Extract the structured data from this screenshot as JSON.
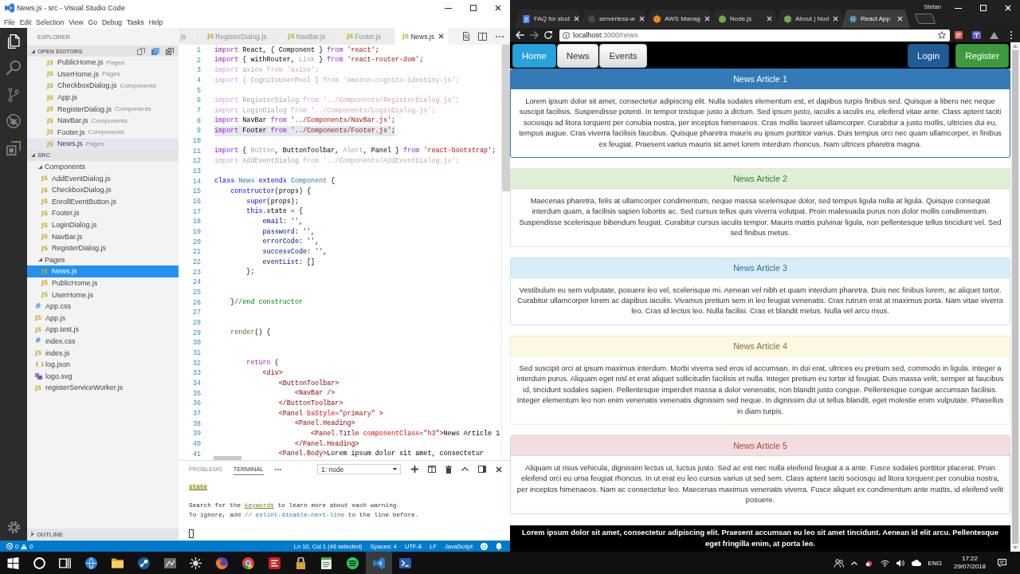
{
  "vscode": {
    "title": "News.js - src - Visual Studio Code",
    "menu": [
      "File",
      "Edit",
      "Selection",
      "View",
      "Go",
      "Debug",
      "Tasks",
      "Help"
    ],
    "activity_bar": [
      {
        "kind": "files",
        "selected": true
      },
      {
        "kind": "search",
        "selected": false
      },
      {
        "kind": "branch",
        "selected": false
      },
      {
        "kind": "bug",
        "selected": false
      },
      {
        "kind": "blocks",
        "selected": false
      }
    ],
    "sidebar": {
      "title": "EXPLORER",
      "open_editors": {
        "label": "OPEN EDITORS",
        "expanded": true,
        "items": [
          {
            "name": "PublicHome.js",
            "folder": "Pages",
            "kind": "js",
            "icon": "JS",
            "selected": false
          },
          {
            "name": "UserHome.js",
            "folder": "Pages",
            "kind": "js",
            "icon": "JS",
            "selected": false
          },
          {
            "name": "CheckboxDialog.js",
            "folder": "Components",
            "kind": "js",
            "icon": "JS",
            "selected": false
          },
          {
            "name": "App.js",
            "kind": "js",
            "icon": "JS",
            "selected": false
          },
          {
            "name": "RegisterDialog.js",
            "folder": "Components",
            "kind": "js",
            "icon": "JS",
            "selected": false
          },
          {
            "name": "NavBar.js",
            "folder": "Components",
            "kind": "js",
            "icon": "JS",
            "selected": false
          },
          {
            "name": "Footer.js",
            "folder": "Components",
            "kind": "js",
            "icon": "JS",
            "selected": false
          },
          {
            "name": "News.js",
            "folder": "Pages",
            "kind": "js",
            "icon": "JS",
            "selected": true
          }
        ]
      },
      "root": {
        "label": "SRC",
        "expanded": true,
        "children": [
          {
            "name": "Components",
            "kind": "folder",
            "expanded": true,
            "selected": false,
            "children": [
              {
                "name": "AddEventDialog.js",
                "kind": "js",
                "icon": "JS",
                "selected": false
              },
              {
                "name": "CheckboxDialog.js",
                "kind": "js",
                "icon": "JS",
                "selected": false
              },
              {
                "name": "EnrollEventButton.js",
                "kind": "js",
                "icon": "JS",
                "selected": false
              },
              {
                "name": "Footer.js",
                "kind": "js",
                "icon": "JS",
                "selected": false
              },
              {
                "name": "LoginDialog.js",
                "kind": "js",
                "icon": "JS",
                "selected": false
              },
              {
                "name": "NavBar.js",
                "kind": "js",
                "icon": "JS",
                "selected": false
              },
              {
                "name": "RegisterDialog.js",
                "kind": "js",
                "icon": "JS",
                "selected": false
              }
            ]
          },
          {
            "name": "Pages",
            "kind": "folder",
            "expanded": true,
            "selected": false,
            "children": [
              {
                "name": "News.js",
                "kind": "js",
                "icon": "JS",
                "selected": true
              },
              {
                "name": "PublicHome.js",
                "kind": "js",
                "icon": "JS",
                "selected": false
              },
              {
                "name": "UserHome.js",
                "kind": "js",
                "icon": "JS",
                "selected": false
              }
            ]
          },
          {
            "name": "App.css",
            "kind": "css",
            "icon": "#",
            "selected": false
          },
          {
            "name": "App.js",
            "kind": "js",
            "icon": "JS",
            "selected": false
          },
          {
            "name": "App.test.js",
            "kind": "js",
            "icon": "JS",
            "selected": false
          },
          {
            "name": "index.css",
            "kind": "css",
            "icon": "#",
            "selected": false
          },
          {
            "name": "index.js",
            "kind": "js",
            "icon": "JS",
            "selected": false
          },
          {
            "name": "log.json",
            "kind": "json",
            "icon": "{ }",
            "selected": false
          },
          {
            "name": "logo.svg",
            "kind": "svg",
            "selected": false
          },
          {
            "name": "registerServiceWorker.js",
            "kind": "js",
            "icon": "JS",
            "selected": false
          }
        ]
      },
      "outline": {
        "label": "OUTLINE",
        "expanded": false
      }
    },
    "tabs": [
      {
        "label": "js",
        "selected": false
      },
      {
        "icon": "JS",
        "label": "RegisterDialog.js",
        "selected": false
      },
      {
        "icon": "JS",
        "label": "NavBar.js",
        "selected": false
      },
      {
        "icon": "JS",
        "label": "Footer.js",
        "selected": false
      },
      {
        "icon": "JS",
        "label": "News.js",
        "selected": true
      }
    ],
    "editor": {
      "lines": [
        {
          "number": "1",
          "selected": false,
          "tokens": [
            {
              "text": "import ",
              "kind": "ctl"
            },
            {
              "text": "React, { Component } ",
              "kind": "txt"
            },
            {
              "text": "from ",
              "kind": "ctl"
            },
            {
              "text": "'react'",
              "kind": "str"
            },
            {
              "text": ";",
              "kind": "txt"
            }
          ]
        },
        {
          "number": "2",
          "selected": false,
          "tokens": [
            {
              "text": "import ",
              "kind": "ctl"
            },
            {
              "text": "{ withRouter, ",
              "kind": "txt"
            },
            {
              "text": "Link",
              "kind": "dim"
            },
            {
              "text": " } ",
              "kind": "txt"
            },
            {
              "text": "from ",
              "kind": "ctl"
            },
            {
              "text": "'react-router-dom'",
              "kind": "str"
            },
            {
              "text": ";",
              "kind": "txt"
            }
          ]
        },
        {
          "number": "3",
          "selected": false,
          "tokens": [
            {
              "text": "import ",
              "kind": "dctl"
            },
            {
              "text": "axios ",
              "kind": "dim"
            },
            {
              "text": "from ",
              "kind": "dctl"
            },
            {
              "text": "'axios'",
              "kind": "dstr"
            },
            {
              "text": ";",
              "kind": "dim"
            }
          ]
        },
        {
          "number": "4",
          "selected": false,
          "tokens": [
            {
              "text": "import ",
              "kind": "dctl"
            },
            {
              "text": "{ CognitoUserPool } ",
              "kind": "dim"
            },
            {
              "text": "from ",
              "kind": "dctl"
            },
            {
              "text": "'amazon-cognito-identity-js'",
              "kind": "dstr"
            },
            {
              "text": ";",
              "kind": "dim"
            }
          ]
        },
        {
          "number": "5",
          "selected": false
        },
        {
          "number": "6",
          "selected": false,
          "tokens": [
            {
              "text": "import ",
              "kind": "dctl"
            },
            {
              "text": "RegisterDialog ",
              "kind": "dim"
            },
            {
              "text": "from ",
              "kind": "dctl"
            },
            {
              "text": "'../Components/RegisterDialog.js'",
              "kind": "dstr"
            },
            {
              "text": ";",
              "kind": "dim"
            }
          ]
        },
        {
          "number": "7",
          "selected": false,
          "tokens": [
            {
              "text": "import ",
              "kind": "dctl"
            },
            {
              "text": "LoginDialog ",
              "kind": "dim"
            },
            {
              "text": "from ",
              "kind": "dctl"
            },
            {
              "text": "'../Components/LoginDialog.js'",
              "kind": "dstr"
            },
            {
              "text": ";",
              "kind": "dim"
            }
          ]
        },
        {
          "number": "8",
          "selected": false,
          "tokens": [
            {
              "text": "import ",
              "kind": "ctl"
            },
            {
              "text": "NavBar ",
              "kind": "txt"
            },
            {
              "text": "from ",
              "kind": "ctl"
            },
            {
              "text": "'../Components/NavBar.js'",
              "kind": "str"
            },
            {
              "text": ";",
              "kind": "txt"
            }
          ]
        },
        {
          "number": "9",
          "selected": true,
          "tokens": [
            {
              "text": "import ",
              "kind": "ctl"
            },
            {
              "text": "Footer ",
              "kind": "txt"
            },
            {
              "text": "from ",
              "kind": "ctl"
            },
            {
              "text": "'../Components/Footer.js'",
              "kind": "str"
            },
            {
              "text": ";",
              "kind": "txt"
            }
          ]
        },
        {
          "number": "10",
          "selected": false
        },
        {
          "number": "11",
          "selected": false,
          "tokens": [
            {
              "text": "import ",
              "kind": "ctl"
            },
            {
              "text": "{ ",
              "kind": "txt"
            },
            {
              "text": "Button",
              "kind": "dim"
            },
            {
              "text": ", ButtonToolbar, ",
              "kind": "txt"
            },
            {
              "text": "Alert",
              "kind": "dim"
            },
            {
              "text": ", Panel } ",
              "kind": "txt"
            },
            {
              "text": "from ",
              "kind": "ctl"
            },
            {
              "text": "'react-bootstrap'",
              "kind": "str"
            },
            {
              "text": ";",
              "kind": "txt"
            }
          ]
        },
        {
          "number": "12",
          "selected": false,
          "tokens": [
            {
              "text": "import ",
              "kind": "dctl"
            },
            {
              "text": "AddEventDialog ",
              "kind": "dim"
            },
            {
              "text": "from ",
              "kind": "dctl"
            },
            {
              "text": "'../Components/AddEventDialog.js'",
              "kind": "dstr"
            },
            {
              "text": ";",
              "kind": "dim"
            }
          ]
        },
        {
          "number": "13",
          "selected": false
        },
        {
          "number": "14",
          "selected": false,
          "tokens": [
            {
              "text": "class ",
              "kind": "kw"
            },
            {
              "text": "News ",
              "kind": "type"
            },
            {
              "text": "extends ",
              "kind": "kw"
            },
            {
              "text": "Component ",
              "kind": "type"
            },
            {
              "text": "{",
              "kind": "txt"
            }
          ]
        },
        {
          "number": "15",
          "selected": false,
          "tokens": [
            {
              "text": "    constructor",
              "kind": "kw"
            },
            {
              "text": "(props) {",
              "kind": "txt"
            }
          ]
        },
        {
          "number": "16",
          "selected": false,
          "tokens": [
            {
              "text": "        super",
              "kind": "kw"
            },
            {
              "text": "(props);",
              "kind": "txt"
            }
          ]
        },
        {
          "number": "17",
          "selected": false,
          "tokens": [
            {
              "text": "        this",
              "kind": "kw"
            },
            {
              "text": ".state = {",
              "kind": "txt"
            }
          ]
        },
        {
          "number": "18",
          "selected": false,
          "tokens": [
            {
              "text": "            email",
              "kind": "prop"
            },
            {
              "text": ": ",
              "kind": "txt"
            },
            {
              "text": "''",
              "kind": "str"
            },
            {
              "text": ",",
              "kind": "txt"
            }
          ]
        },
        {
          "number": "19",
          "selected": false,
          "tokens": [
            {
              "text": "            password",
              "kind": "prop"
            },
            {
              "text": ": ",
              "kind": "txt"
            },
            {
              "text": "''",
              "kind": "str"
            },
            {
              "text": ",",
              "kind": "txt"
            }
          ]
        },
        {
          "number": "20",
          "selected": false,
          "tokens": [
            {
              "text": "            errorCode",
              "kind": "prop"
            },
            {
              "text": ": ",
              "kind": "txt"
            },
            {
              "text": "''",
              "kind": "str"
            },
            {
              "text": ",",
              "kind": "txt"
            }
          ]
        },
        {
          "number": "21",
          "selected": false,
          "tokens": [
            {
              "text": "            successCode",
              "kind": "prop"
            },
            {
              "text": ": ",
              "kind": "txt"
            },
            {
              "text": "''",
              "kind": "str"
            },
            {
              "text": ",",
              "kind": "txt"
            }
          ]
        },
        {
          "number": "22",
          "selected": false,
          "tokens": [
            {
              "text": "            eventList",
              "kind": "prop"
            },
            {
              "text": ": []",
              "kind": "txt"
            }
          ]
        },
        {
          "number": "23",
          "selected": false,
          "tokens": [
            {
              "text": "        };",
              "kind": "txt"
            }
          ]
        },
        {
          "number": "24",
          "selected": false
        },
        {
          "number": "25",
          "selected": false
        },
        {
          "number": "26",
          "selected": false,
          "tokens": [
            {
              "text": "    }",
              "kind": "txt"
            },
            {
              "text": "//end constructor",
              "kind": "com"
            }
          ]
        },
        {
          "number": "27",
          "selected": false
        },
        {
          "number": "28",
          "selected": false
        },
        {
          "number": "29",
          "selected": false,
          "tokens": [
            {
              "text": "    render",
              "kind": "fn"
            },
            {
              "text": "() {",
              "kind": "txt"
            }
          ]
        },
        {
          "number": "30",
          "selected": false
        },
        {
          "number": "31",
          "selected": false
        },
        {
          "number": "32",
          "selected": false,
          "tokens": [
            {
              "text": "        return ",
              "kind": "ctl"
            },
            {
              "text": "(",
              "kind": "txt"
            }
          ]
        },
        {
          "number": "33",
          "selected": false,
          "tokens": [
            {
              "text": "            <div>",
              "kind": "tag"
            }
          ]
        },
        {
          "number": "34",
          "selected": false,
          "tokens": [
            {
              "text": "                <ButtonToolbar>",
              "kind": "tag"
            }
          ]
        },
        {
          "number": "35",
          "selected": false,
          "tokens": [
            {
              "text": "                    <NavBar />",
              "kind": "tag"
            }
          ]
        },
        {
          "number": "36",
          "selected": false,
          "tokens": [
            {
              "text": "                </ButtonToolbar>",
              "kind": "tag"
            }
          ]
        },
        {
          "number": "37",
          "selected": false,
          "tokens": [
            {
              "text": "                <Panel ",
              "kind": "tag"
            },
            {
              "text": "bsStyle",
              "kind": "attr"
            },
            {
              "text": "=",
              "kind": "txt"
            },
            {
              "text": "\"primary\"",
              "kind": "str"
            },
            {
              "text": " >",
              "kind": "tag"
            }
          ]
        },
        {
          "number": "38",
          "selected": false,
          "tokens": [
            {
              "text": "                    <Panel.Heading>",
              "kind": "tag"
            }
          ]
        },
        {
          "number": "39",
          "selected": false,
          "tokens": [
            {
              "text": "                        <Panel.Title ",
              "kind": "tag"
            },
            {
              "text": "componentClass",
              "kind": "attr"
            },
            {
              "text": "=",
              "kind": "txt"
            },
            {
              "text": "\"h3\"",
              "kind": "str"
            },
            {
              "text": ">",
              "kind": "tag"
            },
            {
              "text": "News Article 1",
              "kind": "txt"
            }
          ]
        },
        {
          "number": "40",
          "selected": false,
          "tokens": [
            {
              "text": "                    </Panel.Heading>",
              "kind": "tag"
            }
          ]
        },
        {
          "number": "41",
          "selected": false,
          "tokens": [
            {
              "text": "                <Panel.Body>",
              "kind": "tag"
            },
            {
              "text": "Lorem ipsum dolor sit amet, consectetur",
              "kind": "txt"
            }
          ]
        }
      ]
    },
    "panel": {
      "tabs": [
        {
          "label": "PROBLEMS",
          "selected": false
        },
        {
          "label": "TERMINAL",
          "selected": true
        }
      ],
      "terminal_picker": "1: node",
      "output": [
        {
          "lines": [
            {
              "tokens": [
                {
                  "text": "state",
                  "kind": "match"
                }
              ]
            }
          ]
        },
        {
          "lines": [
            {
              "tokens": [
                {
                  "text": "Search for the ",
                  "kind": "text"
                },
                {
                  "text": "keywords",
                  "kind": "link"
                },
                {
                  "text": " to learn more about each warning.",
                  "kind": "text"
                }
              ]
            },
            {
              "tokens": [
                {
                  "text": "To ignore, add ",
                  "kind": "text"
                },
                {
                  "text": "// eslint-disable-next-line",
                  "kind": "code"
                },
                {
                  "text": " to the line before.",
                  "kind": "text"
                }
              ]
            }
          ]
        }
      ]
    },
    "status_bar": {
      "errors": "0",
      "warnings": "0",
      "items": [
        "Ln 10, Col 1 (46 selected)",
        "Spaces: 4",
        "UTF-8",
        "LF",
        "JavaScript"
      ]
    }
  },
  "browser": {
    "profile": "Stefan",
    "tabs": [
      {
        "title": "FAQ for stud",
        "kind": "document",
        "selected": false
      },
      {
        "title": "serverless-w",
        "kind": "circle",
        "selected": false
      },
      {
        "title": "AWS Manag",
        "kind": "cube",
        "selected": false
      },
      {
        "title": "Node.js",
        "kind": "hexagon",
        "selected": false
      },
      {
        "title": "About | Nod",
        "kind": "hexagon",
        "selected": false
      },
      {
        "title": "React App",
        "kind": "atom",
        "selected": true
      }
    ],
    "toolbar": {
      "back": {
        "disabled": false
      },
      "forward": {
        "disabled": true
      }
    },
    "address": {
      "host": "localhost",
      "path": ":3000/news"
    },
    "navbar": {
      "left": [
        {
          "label": "Home",
          "kind": "info"
        },
        {
          "label": "News",
          "kind": "default"
        },
        {
          "label": "Events",
          "kind": "default"
        }
      ],
      "right": [
        {
          "label": "Login",
          "kind": "primary"
        },
        {
          "label": "Register",
          "kind": "success"
        }
      ]
    },
    "articles": [
      {
        "title": "News Article 1",
        "kind": "primary",
        "body": "Lorem ipsum dolor sit amet, consectetur adipiscing elit. Nulla sodales elementum est, et dapibus turpis finibus sed. Quisque a libero nec neque suscipit facilisis. Suspendisse potenti. In tempor tristique justo a dictum. Sed ipsum justo, iaculis a iaculis eu, eleifend vitae ante. Class aptent taciti sociosqu ad litora torquent per conubia nostra, per inceptos himenaeos. Cras mollis laoreet ullamcorper. Curabitur a justo mollis, ultricies dui eu, tempus augue. Cras viverra facilisis faucibus. Quisque pharetra mauris eu ipsum porttitor varius. Duis tempus orci nec quam ullamcorper, in finibus ex feugiat. Praesent varius mauris sit amet lorem interdum rhoncus. Nam ultrices pharetra magna."
      },
      {
        "title": "News Article 2",
        "kind": "success",
        "body": "Maecenas pharetra, felis at ullamcorper condimentum, neque massa scelerisque dolor, sed tempus ligula nulla at ligula. Quisque consequat interdum quam, a facilisis sapien lobortis ac. Sed cursus tellus quis viverra volutpat. Proin malesuada purus non dolor mollis condimentum. Suspendisse scelerisque bibendum feugiat. Curabitur cursus iaculis tempor. Mauris mattis pulvinar ligula, non pellentesque tellus tincidunt vel. Sed sed finibus metus."
      },
      {
        "title": "News Article 3",
        "kind": "info",
        "body": "Vestibulum eu sem vulputate, posuere leo vel, scelerisque mi. Aenean vel nibh et quam interdum pharetra. Duis nec finibus lorem, ac aliquet tortor. Curabitur ullamcorper lorem ac dapibus iaculis. Vivamus pretium sem in leo feugiat venenatis. Cras rutrum erat at maximus porta. Nam vitae viverra leo. Cras id lectus leo. Nulla facilisi. Cras et blandit metus. Nulla vel arcu risus."
      },
      {
        "title": "News Article 4",
        "kind": "warning",
        "body": "Sed suscipit orci at ipsum maximus interdum. Morbi viverra sed eros id accumsan. In dui erat, ultrices eu pretium sed, commodo in ligula. Integer a interdum purus. Aliquam eget nisl et erat aliquet sollicitudin facilisis et nulla. Integer pretium eu tortor id feugiat. Duis massa velit, semper at faucibus id, tincidunt sodales sapien. Pellentesque imperdiet massa a dolor venenatis, non blandit justo congue. Pellentesque congue accumsan facilisis. Integer elementum leo non enim venenatis venenatis dignissim sed neque. In dignissim dui ut tellus blandit, eget molestie enim vulputate. Phasellus in diam turpis."
      },
      {
        "title": "News Article 5",
        "kind": "danger",
        "body": "Aliquam ut risus vehicula, dignissim lectus ut, luctus justo. Sed ac est nec nulla eleifend feugiat a a ante. Fusce sodales porttitor placerat. Proin eleifend orci eu urna feugiat rhoncus. In ut erat eu leo cursus varius ut sed sem. Class aptent taciti sociosqu ad litora torquent per conubia nostra, per inceptos himenaeos. Nam ac consectetur leo. Maecenas maximus venenatis viverra. Fusce aliquet ex condimentum ante mattis, id eleifend velit posuere."
      }
    ],
    "footer": "Lorem ipsum dolor sit amet, consectetur adipiscing elit. Praesent accumsan eu leo sit amet tincidunt. Aenean id elit arcu. Pellentesque eget fringilla enim, at porta leo."
  },
  "taskbar": {
    "apps": [
      {
        "kind": "start",
        "selected": false
      },
      {
        "kind": "ring",
        "selected": false
      },
      {
        "kind": "taskview",
        "selected": false
      },
      {
        "kind": "globe",
        "selected": false
      },
      {
        "kind": "folder",
        "selected": false
      },
      {
        "kind": "disc",
        "selected": false
      },
      {
        "kind": "chartwindow",
        "selected": false
      },
      {
        "kind": "sun",
        "selected": false
      },
      {
        "kind": "flameglobe",
        "selected": false
      },
      {
        "kind": "roundlogo",
        "selected": false
      },
      {
        "kind": "squarelogo",
        "selected": false
      },
      {
        "kind": "lock",
        "selected": false
      },
      {
        "kind": "notepad",
        "selected": false
      },
      {
        "kind": "waves",
        "selected": false
      },
      {
        "kind": "ribbon",
        "selected": true
      },
      {
        "kind": "prompt",
        "selected": false
      }
    ],
    "tray": {
      "language": "ENG",
      "time": "17:22",
      "date": "29/07/2018"
    }
  }
}
